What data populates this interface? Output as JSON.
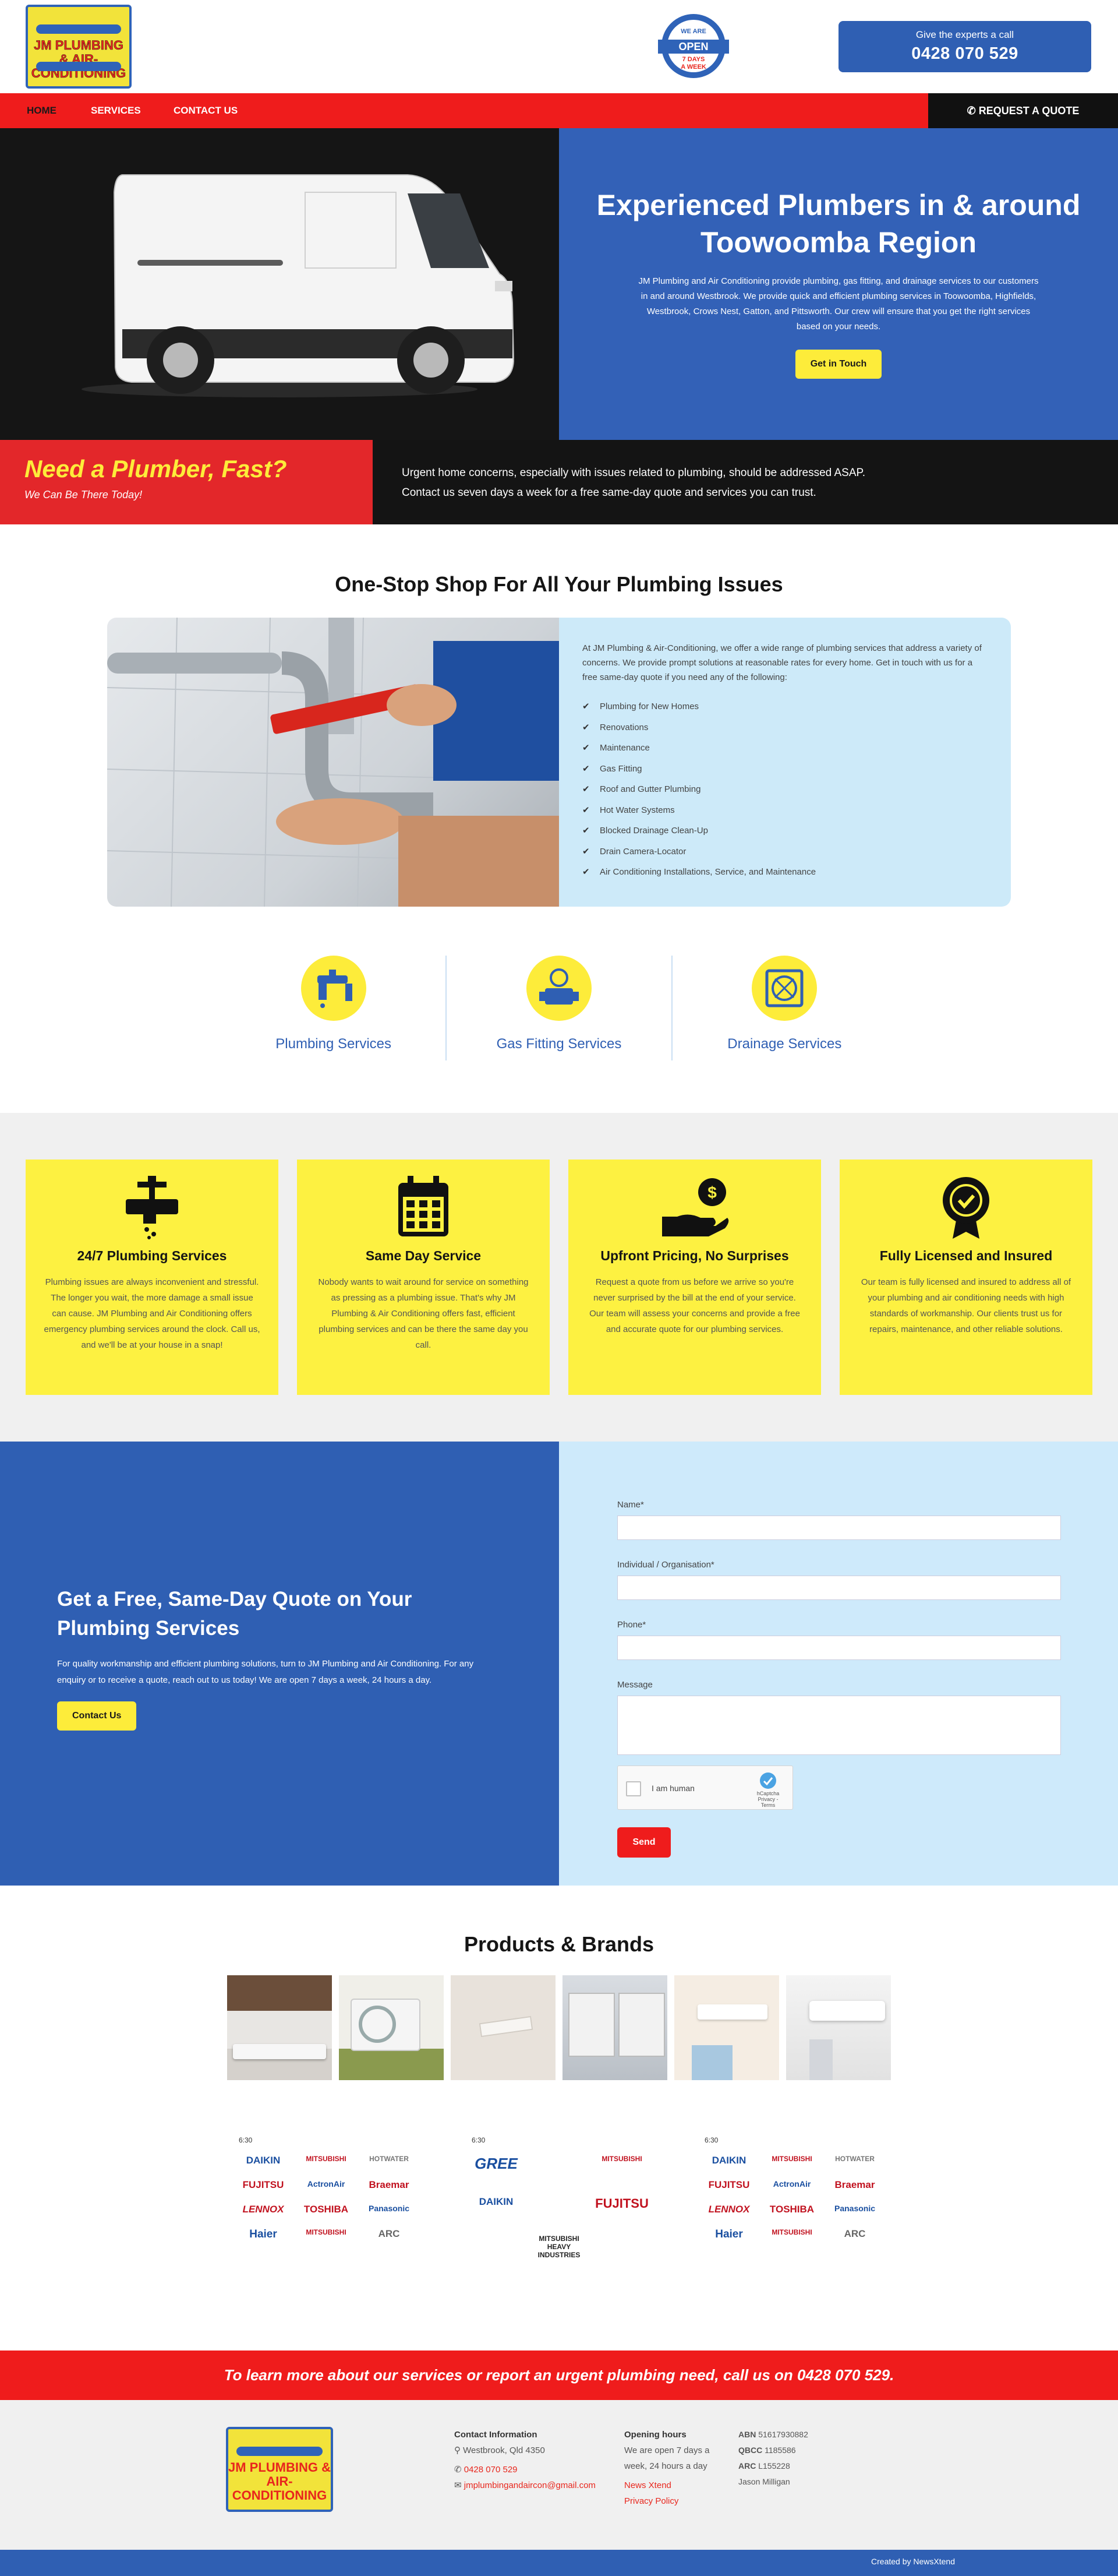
{
  "brand": {
    "logo_text": "JM PLUMBING & AIR-CONDITIONING",
    "open_badge": {
      "top": "WE ARE",
      "main": "OPEN",
      "bottom1": "7 DAYS",
      "bottom2": "A WEEK"
    },
    "call_label": "Give the experts a call",
    "phone": "0428 070 529"
  },
  "nav": {
    "items": [
      "HOME",
      "SERVICES",
      "CONTACT US"
    ],
    "quote_button": "REQUEST A QUOTE"
  },
  "hero": {
    "title": "Experienced Plumbers in & around Toowoomba Region",
    "description": "JM Plumbing and Air Conditioning provide plumbing, gas fitting, and drainage services to our customers in and around Westbrook. We provide quick and efficient plumbing services in Toowoomba, Highfields, Westbrook, Crows Nest, Gatton, and Pittsworth. Our crew will ensure that you get the right services based on your needs.",
    "button": "Get in Touch"
  },
  "need": {
    "title": "Need a Plumber, Fast?",
    "subtitle": "We Can Be There Today!",
    "line1": "Urgent home concerns, especially with issues related to plumbing, should be addressed ASAP.",
    "line2": "Contact us seven days a week for a free same-day quote and services you can trust."
  },
  "onestop": {
    "title": "One-Stop Shop For All Your Plumbing Issues",
    "intro": "At JM Plumbing & Air-Conditioning, we offer a wide range of plumbing services that address a variety of concerns. We provide prompt solutions at reasonable rates for every home. Get in touch with us for a free same-day quote if you need any of the following:",
    "list": [
      "Plumbing for New Homes",
      "Renovations",
      "Maintenance",
      "Gas Fitting",
      "Roof and Gutter Plumbing",
      "Hot Water Systems",
      "Blocked Drainage Clean-Up",
      "Drain Camera-Locator",
      "Air Conditioning Installations, Service, and Maintenance"
    ],
    "services": [
      "Plumbing Services",
      "Gas Fitting Services",
      "Drainage Services"
    ]
  },
  "features": [
    {
      "title": "24/7 Plumbing Services",
      "icon": "tap-icon",
      "text": "Plumbing issues are always inconvenient and stressful. The longer you wait, the more damage a small issue can cause. JM Plumbing and Air Conditioning offers emergency plumbing services around the clock. Call us, and we'll be at your house in a snap!"
    },
    {
      "title": "Same Day Service",
      "icon": "calendar-icon",
      "text": "Nobody wants to wait around for service on something as pressing as a plumbing issue. That's why JM Plumbing & Air Conditioning offers fast, efficient plumbing services and can be there the same day you call."
    },
    {
      "title": "Upfront Pricing, No Surprises",
      "icon": "money-hand-icon",
      "text": "Request a quote from us before we arrive so you're never surprised by the bill at the end of your service. Our team will assess your concerns and provide a free and accurate quote for our plumbing services."
    },
    {
      "title": "Fully Licensed and Insured",
      "icon": "badge-icon",
      "text": "Our team is fully licensed and insured to address all of your plumbing and air conditioning needs with high standards of workmanship. Our clients trust us for repairs, maintenance, and other reliable solutions."
    }
  ],
  "quote": {
    "title": "Get a Free, Same-Day Quote on Your Plumbing Services",
    "text": "For quality workmanship and efficient plumbing solutions, turn to JM Plumbing and Air Conditioning. For any enquiry or to receive a quote, reach out to us today! We are open 7 days a week, 24 hours a day.",
    "button": "Contact Us",
    "fields": [
      "Name*",
      "Individual / Organisation*",
      "Phone*",
      "Message"
    ],
    "captcha_label": "I am human",
    "captcha_brand": "hCaptcha",
    "captcha_links": "Privacy - Terms",
    "send": "Send"
  },
  "products": {
    "title": "Products & Brands",
    "brand_images": [
      {
        "time": "6:30",
        "brands": [
          "DAIKIN",
          "MITSUBISHI",
          "HOTWATER",
          "FUJITSU",
          "ActronAir",
          "Braemar",
          "LENNOX",
          "TOSHIBA",
          "Panasonic",
          "Haier",
          "MITSUBISHI",
          "ARC"
        ]
      },
      {
        "time": "6:30",
        "brands": [
          "GREE",
          "",
          "MITSUBISHI",
          "DAIKIN",
          "",
          "FUJITSU",
          "",
          "MITSUBISHI HEAVY INDUSTRIES",
          ""
        ]
      },
      {
        "time": "6:30",
        "brands": [
          "DAIKIN",
          "MITSUBISHI",
          "HOTWATER",
          "FUJITSU",
          "ActronAir",
          "Braemar",
          "LENNOX",
          "TOSHIBA",
          "Panasonic",
          "Haier",
          "MITSUBISHI",
          "ARC"
        ]
      }
    ]
  },
  "cta": "To learn more about our services or report an urgent plumbing need, call us on 0428 070 529.",
  "footer": {
    "contact_title": "Contact Information",
    "address": "Westbrook, Qld 4350",
    "phone": "0428 070 529",
    "email": "jmplumbingandaircon@gmail.com",
    "hours_title": "Opening hours",
    "hours": "We are open 7 days a week, 24 hours a day",
    "news_link": "News Xtend",
    "privacy_link": "Privacy Policy",
    "abn_label": "ABN",
    "abn": "51617930882",
    "qbcc_label": "QBCC",
    "qbcc": "1185586",
    "arc_label": "ARC",
    "arc": "L155228",
    "owner": "Jason Milligan",
    "created_by": "Created by NewsXtend"
  },
  "colors": {
    "red": "#ef1c1c",
    "blue": "#2f5fb3",
    "yellow": "#fdec3a",
    "light_blue": "#ceeafb"
  }
}
